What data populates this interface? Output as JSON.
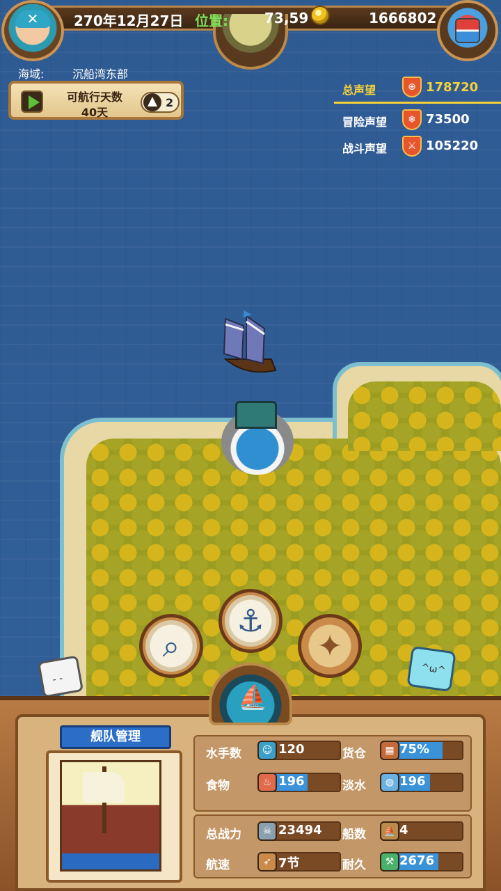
{
  "topbar": {
    "date": "270年12月27日",
    "position_label": "位置:",
    "position_value": "73,59",
    "gold": "1666802"
  },
  "sea_area": {
    "label": "海域:",
    "name": "沉船湾东部"
  },
  "voyage": {
    "title": "可航行天数",
    "days": "40天",
    "nav_count": "2"
  },
  "reputation": {
    "total_label": "总声望",
    "total_value": "178720",
    "items": [
      {
        "label": "冒险声望",
        "value": "73500",
        "icon": "snowflake-icon"
      },
      {
        "label": "战斗声望",
        "value": "105220",
        "icon": "crossed-swords-icon"
      }
    ]
  },
  "fleet": {
    "title": "舰队管理",
    "stats": {
      "sailors": {
        "label": "水手数",
        "value": "120"
      },
      "cargo": {
        "label": "货仓",
        "value": "75%",
        "fill": 0.75
      },
      "food": {
        "label": "食物",
        "value": "196",
        "fill": 0.6
      },
      "water": {
        "label": "淡水",
        "value": "196",
        "fill": 0.6
      },
      "power": {
        "label": "总战力",
        "value": "23494"
      },
      "ships": {
        "label": "船数",
        "value": "4"
      },
      "speed": {
        "label": "航速",
        "value": "7节"
      },
      "durability": {
        "label": "耐久",
        "value": "2676",
        "fill": 0.7
      }
    }
  },
  "colors": {
    "sea": "#2f5c94",
    "reputation_gold": "#f6d23a",
    "bar_blue": "#3a92d8",
    "position_green": "#7ee05a"
  }
}
